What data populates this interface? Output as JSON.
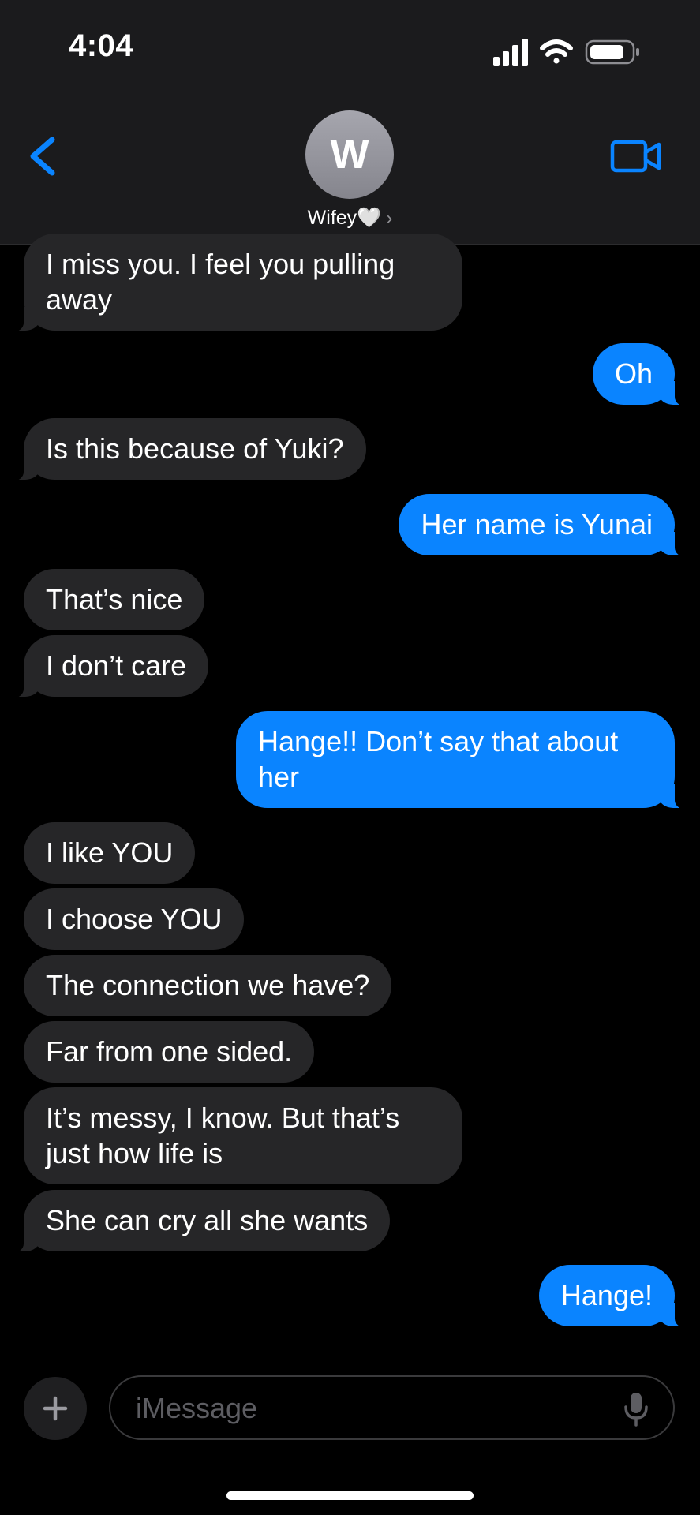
{
  "status_bar": {
    "time": "4:04"
  },
  "header": {
    "avatar_initial": "W",
    "contact_name": "Wifey🤍",
    "chevron": "›"
  },
  "messages": [
    {
      "dir": "in",
      "text": "I miss you. I feel you pulling\naway"
    },
    {
      "dir": "out",
      "text": "Oh"
    },
    {
      "dir": "in",
      "text": "Is this because of Yuki?"
    },
    {
      "dir": "out",
      "text": "Her name is Yunai"
    },
    {
      "dir": "in",
      "text": "That’s nice"
    },
    {
      "dir": "in",
      "text": "I don’t care"
    },
    {
      "dir": "out",
      "text": "Hange!! Don’t say that about\nher"
    },
    {
      "dir": "in",
      "text": "I like YOU"
    },
    {
      "dir": "in",
      "text": "I choose YOU"
    },
    {
      "dir": "in",
      "text": "The connection we have?"
    },
    {
      "dir": "in",
      "text": "Far from one sided."
    },
    {
      "dir": "in",
      "text": "It’s messy, I know. But that’s\njust how life is"
    },
    {
      "dir": "in",
      "text": "She can cry all she wants"
    },
    {
      "dir": "out",
      "text": "Hange!"
    }
  ],
  "input": {
    "placeholder": "iMessage"
  },
  "colors": {
    "accent": "#0a84ff",
    "incoming_bubble": "#262628",
    "header_bg": "#1b1b1d",
    "background": "#000000"
  },
  "icons": {
    "back": "chevron-left-icon",
    "video": "video-camera-icon",
    "signal": "cellular-signal-icon",
    "wifi": "wifi-icon",
    "battery": "battery-icon",
    "plus": "plus-icon",
    "mic": "microphone-icon"
  }
}
